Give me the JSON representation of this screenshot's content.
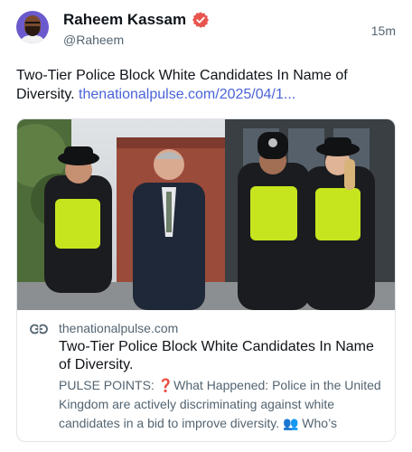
{
  "author": {
    "name": "Raheem Kassam",
    "handle": "@Raheem",
    "time": "15m"
  },
  "post": {
    "text": "Two-Tier Police Block White Candidates In Name of Diversity. ",
    "link": "thenationalpulse.com/2025/04/1..."
  },
  "card": {
    "image_alt": "Police officers walking with a man in a suit",
    "domain": "thenationalpulse.com",
    "title": "Two-Tier Police Block White Candidates In Name of Diversity.",
    "description": "PULSE POINTS: ❓What Happened: Police in the United Kingdom are actively discriminating against white candidates in a bid to improve diversity. 👥 Who’s"
  },
  "colors": {
    "link": "#4a63d8",
    "verified_badge": "#e8554f",
    "secondary_text": "#536471"
  },
  "icons": [
    "verified-badge-icon",
    "link-icon"
  ]
}
